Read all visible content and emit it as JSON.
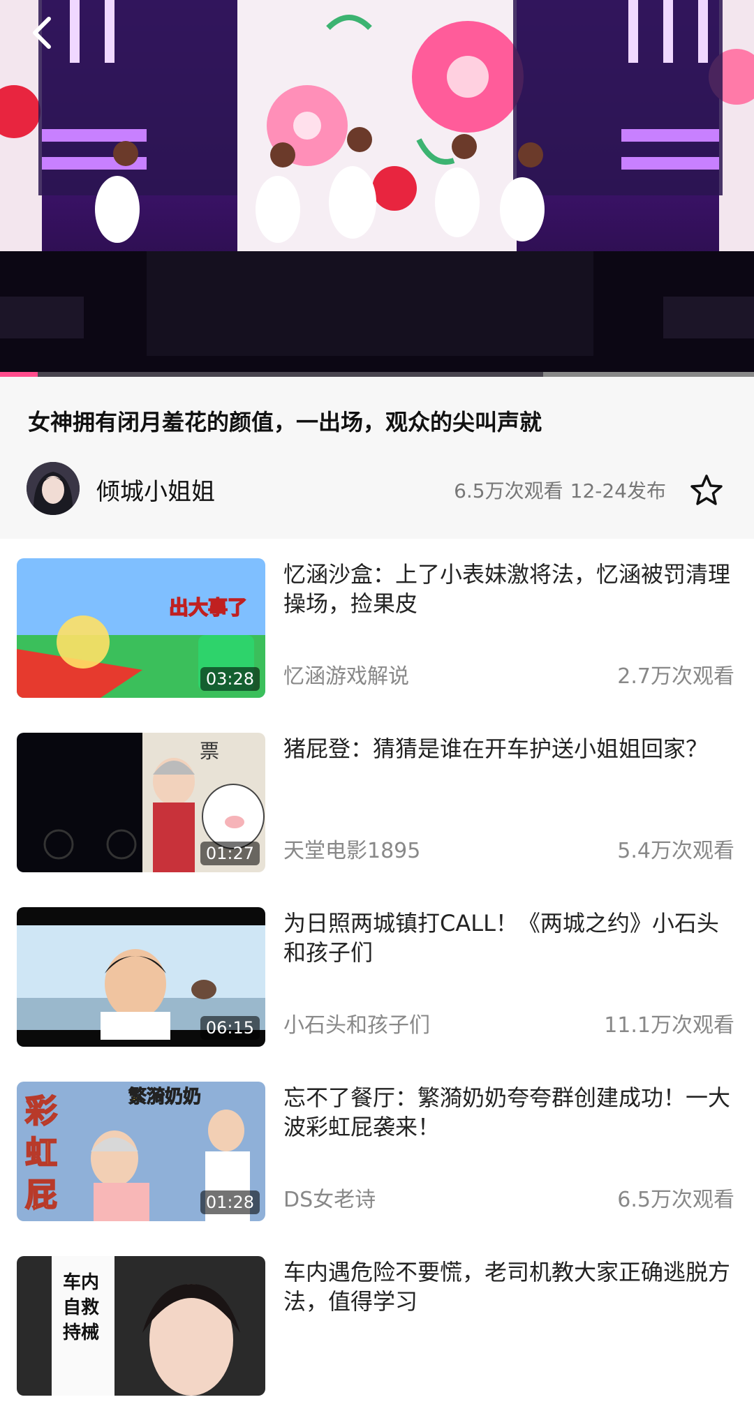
{
  "player": {
    "progress_percent": 5,
    "buffered_start_percent": 72
  },
  "video": {
    "title": "女神拥有闭月羞花的颜值，一出场，观众的尖叫声就",
    "author": "倾城小姐姐",
    "views": "6.5万次观看",
    "date": "12-24发布"
  },
  "icons": {
    "back": "chevron-left-icon",
    "favorite": "star-outline-icon"
  },
  "related": [
    {
      "title": "忆涵沙盒：上了小表妹激将法，忆涵被罚清理操场，捡果皮",
      "channel": "忆涵游戏解说",
      "views": "2.7万次观看",
      "duration": "03:28"
    },
    {
      "title": "猪屁登：猜猜是谁在开车护送小姐姐回家？",
      "channel": "天堂电影1895",
      "views": "5.4万次观看",
      "duration": "01:27"
    },
    {
      "title": "为日照两城镇打CALL！《两城之约》小石头和孩子们",
      "channel": "小石头和孩子们",
      "views": "11.1万次观看",
      "duration": "06:15"
    },
    {
      "title": "忘不了餐厅：繁漪奶奶夸夸群创建成功！一大波彩虹屁袭来！",
      "channel": "DS女老诗",
      "views": "6.5万次观看",
      "duration": "01:28"
    },
    {
      "title": "车内遇危险不要慌，老司机教大家正确逃脱方法，值得学习",
      "channel": "",
      "views": "",
      "duration": ""
    }
  ]
}
